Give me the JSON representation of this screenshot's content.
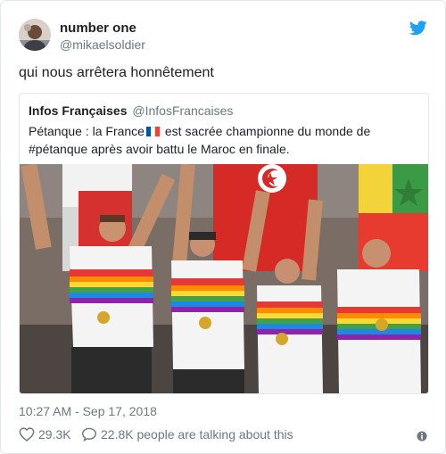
{
  "tweet": {
    "author_name": "number one",
    "author_handle": "@mikaelsoldier",
    "text": "qui nous arrêtera honnêtement",
    "timestamp": "10:27 AM - Sep 17, 2018",
    "likes": "29.3K",
    "talking": "22.8K people are talking about this"
  },
  "quoted": {
    "author_name": "Infos Françaises",
    "author_handle": "@InfosFrancaises",
    "text_before_flag": "Pétanque : la France",
    "flag_icon": "france-flag-emoji",
    "text_after_flag": " est sacrée championne du monde de #pétanque après avoir battu le Maroc en finale."
  },
  "icons": {
    "brand": "twitter-bird-icon",
    "like": "heart-icon",
    "reply": "speech-bubble-icon",
    "info": "info-icon"
  },
  "colors": {
    "twitter_blue": "#1da1f2",
    "text_secondary": "#697882",
    "border": "#e1e8ed"
  }
}
